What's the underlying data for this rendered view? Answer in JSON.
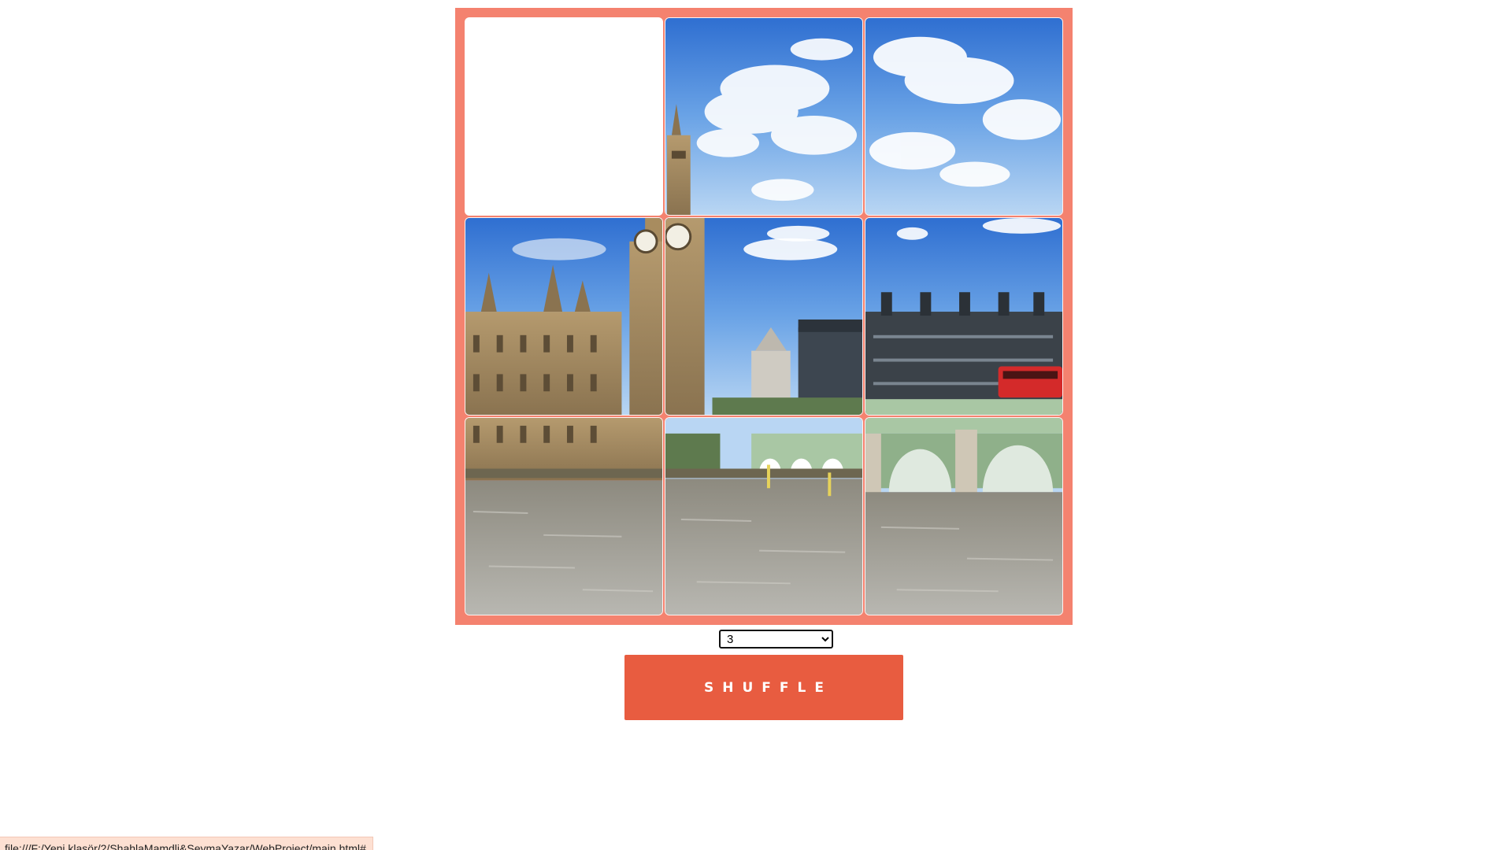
{
  "puzzle": {
    "grid_size": 3,
    "empty_slot": "top-left",
    "frame_color": "#f4826f",
    "image_subject": "Big Ben, Houses of Parliament and Westminster Bridge",
    "tiles": [
      {
        "slot": "r1c2",
        "piece": "sky-clouds-upper-middle"
      },
      {
        "slot": "r1c3",
        "piece": "sky-clouds-upper-right"
      },
      {
        "slot": "r2c1",
        "piece": "parliament-and-big-ben"
      },
      {
        "slot": "r2c2",
        "piece": "big-ben-tower-and-sky"
      },
      {
        "slot": "r2c3",
        "piece": "portcullis-house-and-red-bus"
      },
      {
        "slot": "r3c1",
        "piece": "river-left"
      },
      {
        "slot": "r3c2",
        "piece": "river-and-bridge-middle"
      },
      {
        "slot": "r3c3",
        "piece": "westminster-bridge-right"
      }
    ]
  },
  "controls": {
    "size_select": {
      "selected": "3",
      "options": [
        "3"
      ]
    },
    "shuffle_label": "SHUFFLE",
    "shuffle_color": "#e85c40"
  },
  "status_bar": {
    "url": "file:///F:/Yeni klasör/2/ShahlaMamdli&SeymaYazar/WebProject/main.html#"
  }
}
